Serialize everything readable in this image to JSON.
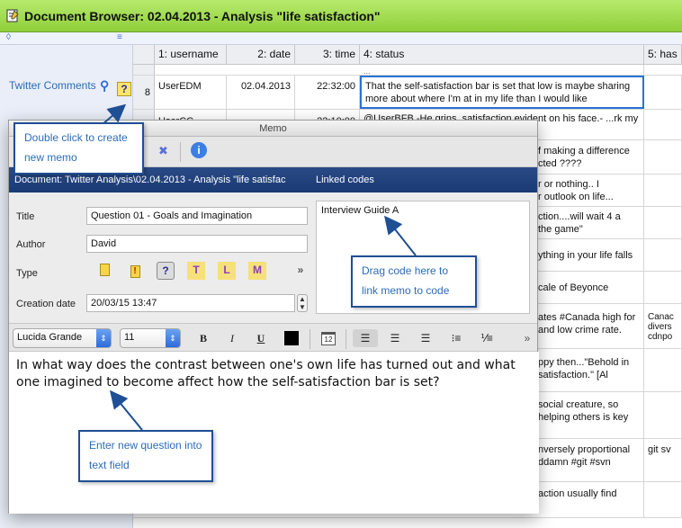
{
  "window": {
    "title": "Document Browser: 02.04.2013 - Analysis \"life satisfaction\""
  },
  "left_panel": {
    "item_label": "Twitter Comments",
    "item_icon": "code-icon",
    "memo_icon_glyph": "?"
  },
  "grid": {
    "headers": [
      "1: username",
      "2: date",
      "3: time",
      "4: status",
      "5: has"
    ],
    "rows": [
      {
        "num": "",
        "username": "",
        "date": "",
        "time": "",
        "status": "..."
      },
      {
        "num": "8",
        "username": "UserEDM",
        "date": "02.04.2013",
        "time": "22:32:00",
        "status": "That the self-satisfaction bar is set that low is maybe sharing more about where I'm at in my life than I would like"
      },
      {
        "num": "",
        "username": "UserCC",
        "date": "",
        "time": "22:10:00",
        "status": "@UserBFB -He grins, satisfaction evident on his face.- ...rk my words."
      }
    ],
    "status_fragments": [
      "f making a difference",
      "cted ????",
      "r or nothing.. I",
      "r outlook on life...",
      "ction....will wait 4 a",
      "the game\"",
      "ything in your life falls",
      "cale of Beyonce",
      "ates #Canada high for",
      "and low crime rate.",
      "ppy then...\"Behold in",
      "satisfaction.\" [Al",
      "social creature, so",
      "helping others is key",
      "nversely proportional",
      "ddamn #git #svn",
      "action usually find"
    ],
    "col5_fragments": [
      "Canac",
      "divers",
      "cdnpo",
      "git sv"
    ]
  },
  "memo": {
    "dialog_title": "Memo",
    "header_path": "Document: Twitter Analysis\\02.04.2013 - Analysis \"life satisfac",
    "linked_codes_label": "Linked codes",
    "fields": {
      "title_label": "Title",
      "title_value": "Question 01 - Goals and Imagination",
      "author_label": "Author",
      "author_value": "David",
      "type_label": "Type",
      "creation_label": "Creation date",
      "creation_value": "20/03/15 13:47"
    },
    "type_icons": [
      "?",
      "T",
      "L",
      "M"
    ],
    "linked_code": "Interview Guide A",
    "format": {
      "font": "Lucida Grande",
      "size": "11",
      "bold": "B",
      "italic": "I",
      "underline": "U"
    },
    "body_text": "In what way does the contrast between one's own life has turned out and what one imagined to become affect how the self-satisfaction bar is set?"
  },
  "callouts": {
    "double_click": "Double click to create new memo",
    "drag_code": "Drag code here to link memo to code",
    "enter_question": "Enter new question into text field"
  },
  "colors": {
    "titlebar": "#a3dc52",
    "memo_header": "#1f3f7a",
    "callout_border": "#1f4f94",
    "callout_text": "#2b6cb8"
  }
}
